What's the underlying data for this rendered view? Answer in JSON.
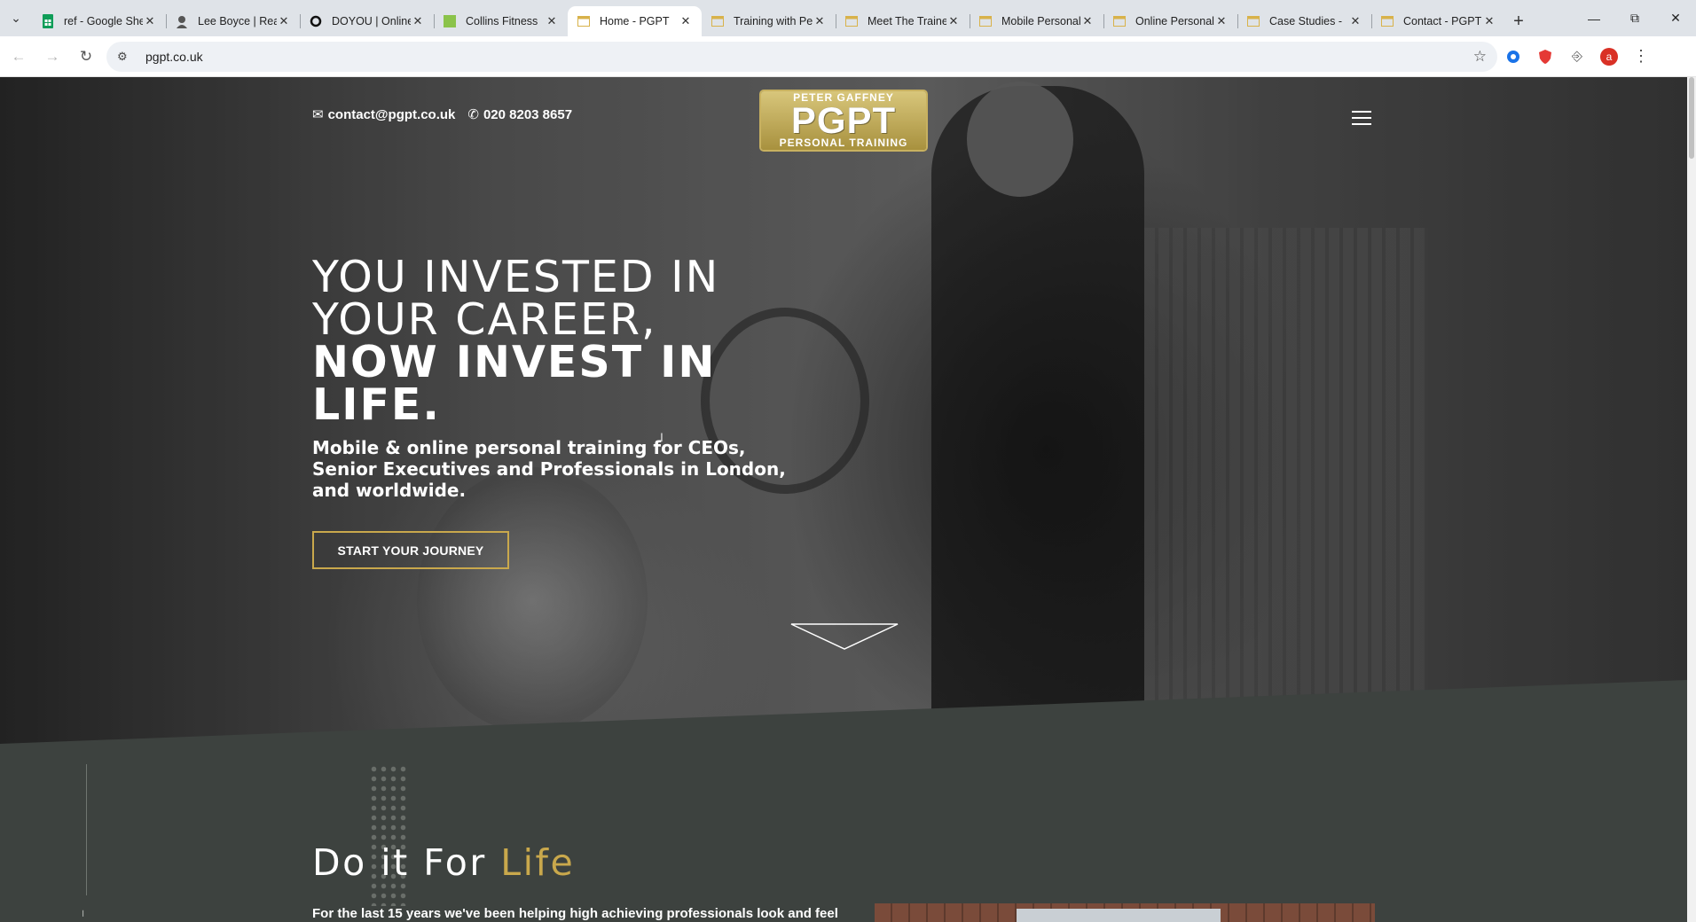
{
  "browser": {
    "tabs": [
      {
        "title": "ref - Google Sheets",
        "favicon": "sheets-icon",
        "active": false
      },
      {
        "title": "Lee Boyce | Real",
        "favicon": "person-avatar-icon",
        "active": false
      },
      {
        "title": "DOYOU | Online",
        "favicon": "circle-logo-icon",
        "active": false
      },
      {
        "title": "Collins Fitness",
        "favicon": "green-square-icon",
        "active": false
      },
      {
        "title": "Home - PGPT",
        "favicon": "page-icon",
        "active": true
      },
      {
        "title": "Training with Peter",
        "favicon": "page-icon",
        "active": false
      },
      {
        "title": "Meet The Trainer",
        "favicon": "page-icon",
        "active": false
      },
      {
        "title": "Mobile Personal",
        "favicon": "page-icon",
        "active": false
      },
      {
        "title": "Online Personal",
        "favicon": "page-icon",
        "active": false
      },
      {
        "title": "Case Studies -",
        "favicon": "page-icon",
        "active": false
      },
      {
        "title": "Contact - PGPT",
        "favicon": "page-icon",
        "active": false
      }
    ],
    "new_tab": "+",
    "url": "pgpt.co.uk",
    "profile_initial": "a"
  },
  "site": {
    "email": "contact@pgpt.co.uk",
    "phone": "020 8203 8657",
    "logo": {
      "top": "PETER GAFFNEY",
      "mid": "PGPT",
      "bottom": "PERSONAL TRAINING"
    },
    "hero": {
      "line1": "YOU INVESTED IN",
      "line2": "YOUR CAREER,",
      "line3": "NOW INVEST IN",
      "line4": "LIFE.",
      "subheading": "Mobile & online personal training for CEOs, Senior Executives and Professionals in London, and worldwide.",
      "cta": "START YOUR JOURNEY"
    },
    "section": {
      "title_main": "Do it For ",
      "title_accent": "Life",
      "body": "For the last 15 years we've been helping high achieving professionals look and feel"
    }
  },
  "colors": {
    "accent": "#c9a84c",
    "section_bg": "#3d423f"
  }
}
